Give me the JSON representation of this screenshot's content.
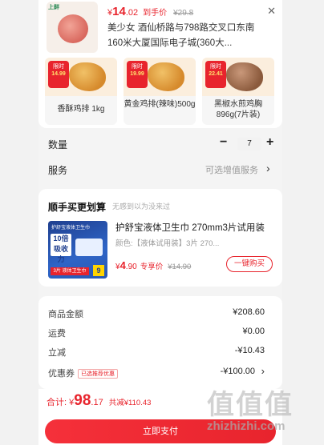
{
  "product": {
    "shop_tag": "上鲜",
    "price_yen": "¥",
    "price_int": "14",
    "price_dec": ".02",
    "price_label": "到手价",
    "orig_price": "¥29.8",
    "address": "美少女  酒仙桥路与798路交叉口东南160米大厦国际电子城(360大..."
  },
  "recommendations": [
    {
      "badge_top": "限时",
      "badge_price": "14.99",
      "name": "香酥鸡排 1kg"
    },
    {
      "badge_top": "限时",
      "badge_price": "19.99",
      "name": "黄金鸡排(辣味)500g"
    },
    {
      "badge_top": "限时",
      "badge_price": "22.41",
      "name": "黑椒水煎鸡胸896g(7片装)"
    }
  ],
  "quantity": {
    "label": "数量",
    "minus": "−",
    "value": "7",
    "plus": "+"
  },
  "service": {
    "label": "服务",
    "value": "可选增值服务",
    "chevron": "›"
  },
  "addon": {
    "title": "顺手买更划算",
    "hint": "无感到以为没来过",
    "pad_brand": "护舒宝液体卫生巾",
    "pad_big": "10倍吸收力",
    "pad_foot": "3片 液体卫生巾",
    "pad_num": "9",
    "name": "护舒宝液体卫生巾 270mm3片试用装",
    "spec": "颜色:【液体试用装】3片 270...",
    "price_yen": "¥",
    "price_int": "4",
    "price_dec": ".90",
    "price_label": "专享价",
    "orig_price": "¥14.90",
    "buy_label": "一键购买"
  },
  "summary": {
    "goods_label": "商品金额",
    "goods_value": "¥208.60",
    "ship_label": "运费",
    "ship_value": "¥0.00",
    "discount_label": "立减",
    "discount_value": "-¥10.43",
    "coupon_label": "优惠券",
    "coupon_tag": "已选推荐优惠",
    "coupon_value": "-¥100.00",
    "coupon_chevron": "›"
  },
  "footer": {
    "total_label": "合计:",
    "total_yen": "¥",
    "total_int": "98",
    "total_dec": ".17",
    "save_label": "共减¥110.43",
    "pay_label": "立即支付"
  },
  "watermark": {
    "glyphs": "值值值",
    "site": "zhizhizhi.com"
  },
  "colors": {
    "accent": "#e8242d",
    "background": "#f4f4f4"
  },
  "icons": [
    "close-icon",
    "chevron-right-icon"
  ]
}
